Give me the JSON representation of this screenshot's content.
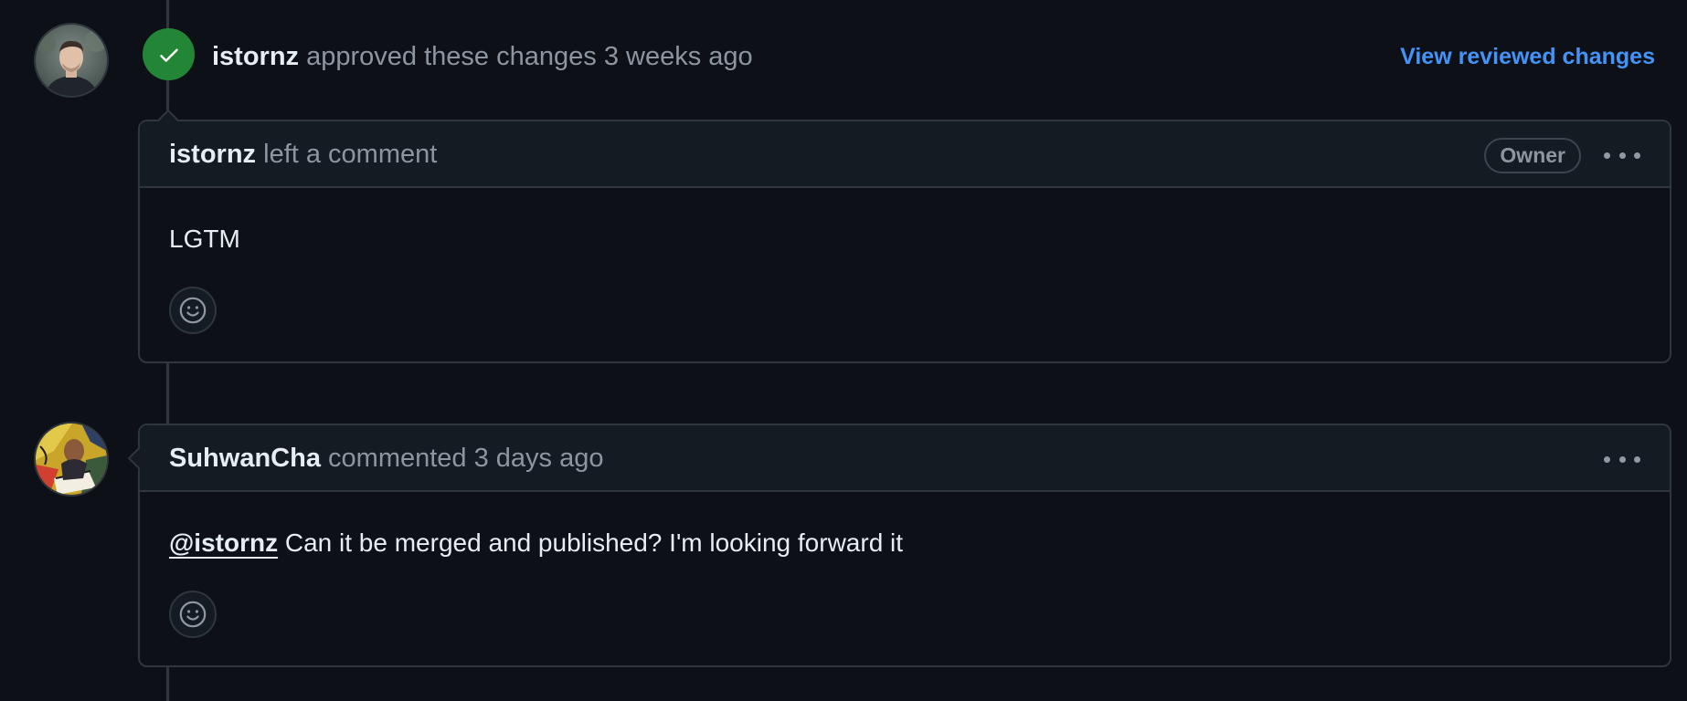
{
  "review": {
    "author": "istornz",
    "action_text": "approved these changes",
    "time": "3 weeks ago",
    "view_changes_label": "View reviewed changes"
  },
  "comments": [
    {
      "author": "istornz",
      "action_text": "left a comment",
      "badge": "Owner",
      "body": "LGTM"
    },
    {
      "author": "SuhwanCha",
      "action_text": "commented",
      "time": "3 days ago",
      "mention": "@istornz",
      "body": "Can it be merged and published? I'm looking forward it"
    }
  ],
  "colors": {
    "background": "#0d1117",
    "accent_link": "#4493f8",
    "approved_green": "#238636",
    "border": "#30363d"
  },
  "icons": {
    "review_status": "check-icon",
    "reaction": "smiley-icon",
    "menu": "kebab-horizontal-icon"
  }
}
